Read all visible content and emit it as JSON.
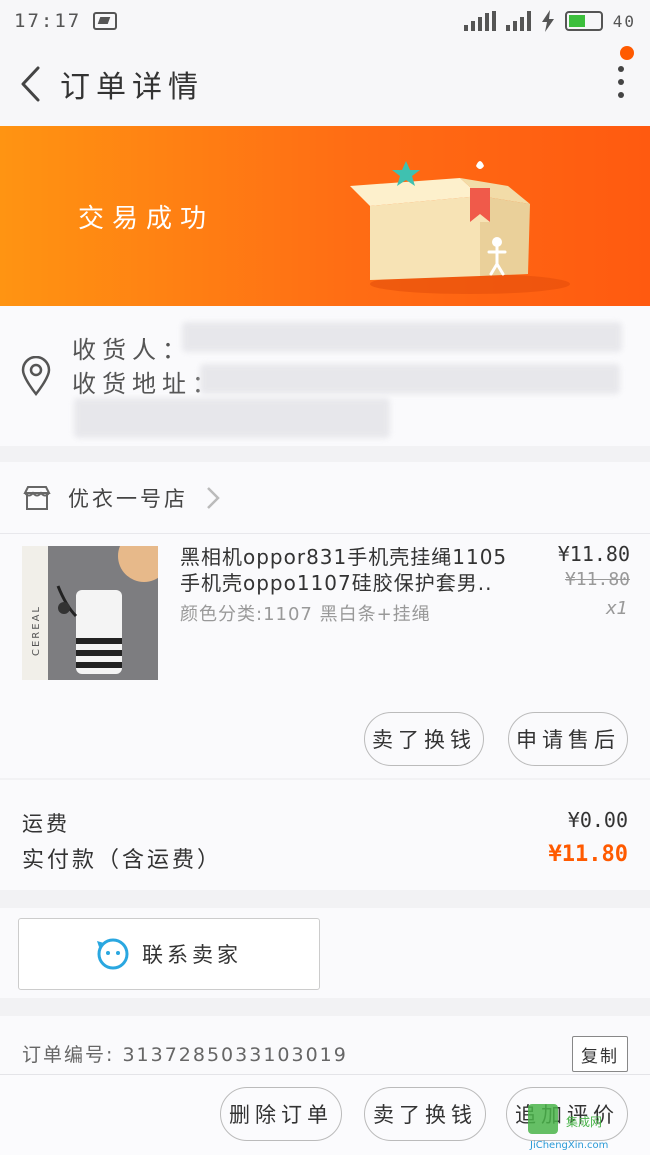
{
  "status_bar": {
    "time": "17:17",
    "battery": "40"
  },
  "nav": {
    "title": "订单详情"
  },
  "banner": {
    "status_text": "交易成功"
  },
  "address": {
    "receiver_label": "收货人：",
    "address_label": "收货地址："
  },
  "shop": {
    "name": "优衣一号店"
  },
  "product": {
    "title": "黑相机oppor831手机壳挂绳1105手机壳oppo1107硅胶保护套男..",
    "sku": "颜色分类:1107 黑白条+挂绳",
    "price": "¥11.80",
    "original_price": "¥11.80",
    "quantity": "x1",
    "image_label": "CEREAL"
  },
  "item_actions": {
    "sell_label": "卖了换钱",
    "after_sale_label": "申请售后"
  },
  "costs": {
    "shipping_label": "运费",
    "shipping_value": "¥0.00",
    "paid_label": "实付款（含运费）",
    "paid_value": "¥11.80"
  },
  "contact": {
    "label": "联系卖家"
  },
  "order_info": {
    "order_number": "订单编号: 3137285033103019",
    "copy_label": "复制"
  },
  "bottom_bar": {
    "delete_label": "删除订单",
    "sell_label": "卖了换钱",
    "review_label": "追加评价"
  },
  "watermark": {
    "mark": "集成网",
    "sub": "JiChengXin.com"
  },
  "colors": {
    "accent": "#ff5a00",
    "banner_start": "#ff9412",
    "banner_end": "#ff5a10"
  }
}
